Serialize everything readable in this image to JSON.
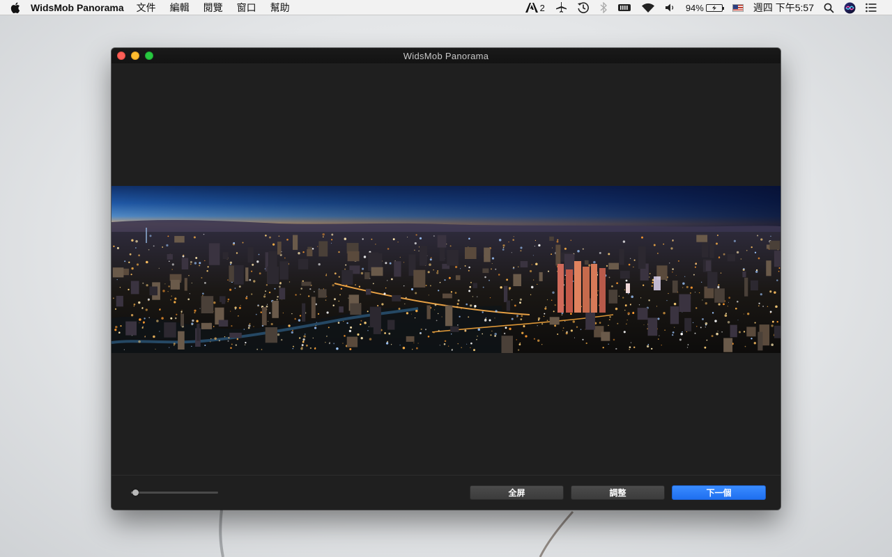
{
  "menubar": {
    "apple_icon": "apple-icon",
    "app_name": "WidsMob Panorama",
    "menus": [
      "文件",
      "編輯",
      "閱覽",
      "窗口",
      "幫助"
    ],
    "status": {
      "adobe_count": "2",
      "battery_percent": "94%",
      "clock": "週四 下午5:57"
    }
  },
  "window": {
    "title": "WidsMob Panorama"
  },
  "bottombar": {
    "zoom_level": 0.02,
    "buttons": {
      "fullscreen": "全屏",
      "adjust": "調整",
      "next": "下一個"
    }
  },
  "colors": {
    "accent": "#2a7cf6",
    "window_bg": "#1f1f1f"
  }
}
